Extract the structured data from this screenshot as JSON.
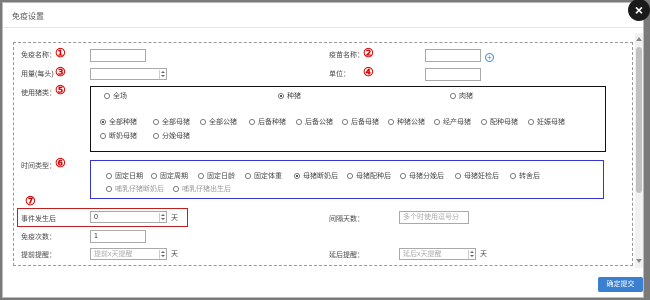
{
  "dialog": {
    "title": "免疫设置",
    "close_symbol": "×"
  },
  "markers": [
    "①",
    "②",
    "③",
    "④",
    "⑤",
    "⑥",
    "⑦"
  ],
  "fields": {
    "immune_name": {
      "label": "免疫名称：",
      "value": ""
    },
    "vaccine_name": {
      "label": "疫苗名称：",
      "value": ""
    },
    "dose": {
      "label": "用量(每头)",
      "value": ""
    },
    "unit": {
      "label": "单位：",
      "value": ""
    },
    "pig_type": {
      "label": "使用猪类："
    },
    "time_type": {
      "label": "时间类型："
    },
    "event_after": {
      "label": "事件发生后",
      "value": "0",
      "unit": "天"
    },
    "interval_days": {
      "label": "间隔天数：",
      "placeholder": "多个时使用逗号分"
    },
    "immune_count": {
      "label": "免疫次数：",
      "value": "1"
    },
    "advance_remind": {
      "label": "提前提醒：",
      "placeholder": "提前x天提醒",
      "unit": "天"
    },
    "delay_remind": {
      "label": "延后提醒：",
      "placeholder": "延后x天提醒",
      "unit": "天"
    }
  },
  "pig_categories": [
    {
      "label": "全场",
      "selected": false
    },
    {
      "label": "种猪",
      "selected": true
    },
    {
      "label": "肉猪",
      "selected": false
    }
  ],
  "pig_subtypes": [
    {
      "label": "全部种猪",
      "selected": true
    },
    {
      "label": "全部母猪",
      "selected": false
    },
    {
      "label": "全部公猪",
      "selected": false
    },
    {
      "label": "后备种猪",
      "selected": false
    },
    {
      "label": "后备公猪",
      "selected": false
    },
    {
      "label": "后备母猪",
      "selected": false
    },
    {
      "label": "种猪公猪",
      "selected": false
    },
    {
      "label": "经产母猪",
      "selected": false
    },
    {
      "label": "配种母猪",
      "selected": false
    },
    {
      "label": "妊娠母猪",
      "selected": false
    },
    {
      "label": "断奶母猪",
      "selected": false
    },
    {
      "label": "分娩母猪",
      "selected": false
    }
  ],
  "time_types": [
    {
      "label": "固定日期",
      "selected": false,
      "disabled": false
    },
    {
      "label": "固定周期",
      "selected": false,
      "disabled": false
    },
    {
      "label": "固定日龄",
      "selected": false,
      "disabled": false
    },
    {
      "label": "固定体重",
      "selected": false,
      "disabled": false
    },
    {
      "label": "母猪断奶后",
      "selected": true,
      "disabled": false
    },
    {
      "label": "母猪配种后",
      "selected": false,
      "disabled": false
    },
    {
      "label": "母猪分娩后",
      "selected": false,
      "disabled": false
    },
    {
      "label": "母猪妊检后",
      "selected": false,
      "disabled": false
    },
    {
      "label": "转舍后",
      "selected": false,
      "disabled": false
    },
    {
      "label": "哺乳仔猪断奶后",
      "selected": false,
      "disabled": true
    },
    {
      "label": "哺乳仔猪出生后",
      "selected": false,
      "disabled": true
    }
  ],
  "submit_label": "确定提交"
}
